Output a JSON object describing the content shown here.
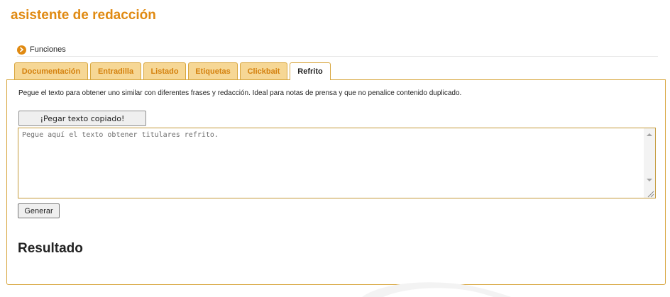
{
  "app": {
    "title": "asistente de redacción"
  },
  "section": {
    "label": "Funciones",
    "icon": "chevron-right-icon"
  },
  "tabs": [
    {
      "label": "Documentación",
      "active": false
    },
    {
      "label": "Entradilla",
      "active": false
    },
    {
      "label": "Listado",
      "active": false
    },
    {
      "label": "Etiquetas",
      "active": false
    },
    {
      "label": "Clickbait",
      "active": false
    },
    {
      "label": "Refrito",
      "active": true
    }
  ],
  "panel": {
    "description": "Pegue el texto para obtener uno similar con diferentes frases y redacción. Ideal para notas de prensa y que no penalice contenido duplicado.",
    "paste_button": "¡Pegar texto copiado!",
    "textarea_value": "",
    "textarea_placeholder": "Pegue aquí el texto obtener titulares refrito.",
    "generate_button": "Generar",
    "result_heading": "Resultado"
  },
  "colors": {
    "accent": "#e08a12",
    "tab_bg": "#f6d795",
    "border": "#d8a63e"
  }
}
